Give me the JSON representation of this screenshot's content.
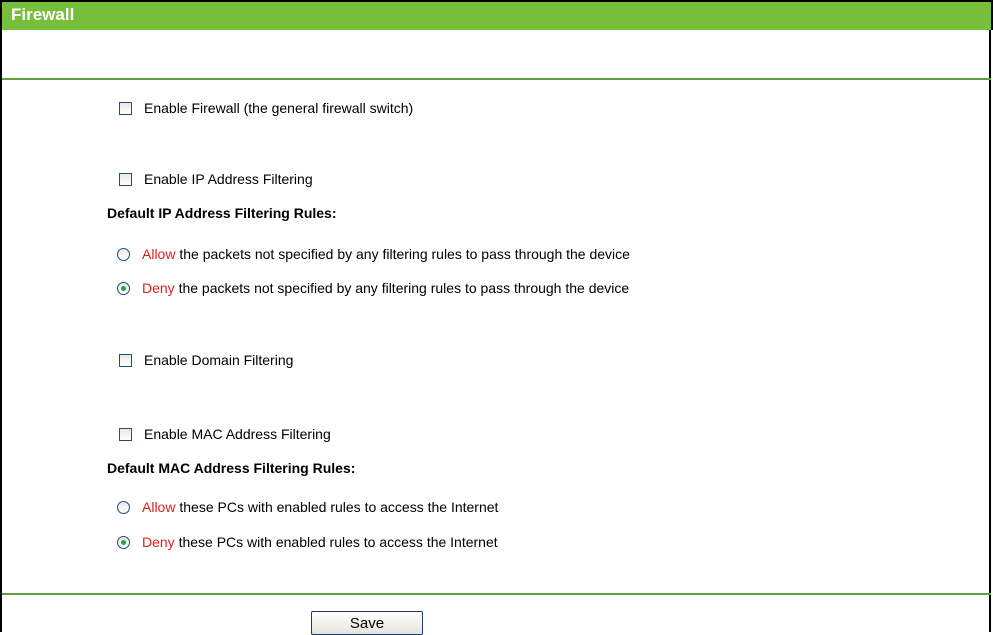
{
  "header": {
    "title": "Firewall"
  },
  "firewall": {
    "enable_label": "Enable Firewall (the general firewall switch)",
    "enabled": false
  },
  "ip_filtering": {
    "enable_label": "Enable IP Address Filtering",
    "enabled": false,
    "rules_heading": "Default IP Address Filtering Rules:",
    "allow_keyword": "Allow",
    "allow_text": " the packets not specified by any filtering rules to pass through the device",
    "deny_keyword": "Deny",
    "deny_text": " the packets not specified by any filtering rules to pass through the device",
    "selected": "deny"
  },
  "domain_filtering": {
    "enable_label": "Enable Domain Filtering",
    "enabled": false
  },
  "mac_filtering": {
    "enable_label": "Enable MAC Address Filtering",
    "enabled": false,
    "rules_heading": "Default MAC Address Filtering Rules:",
    "allow_keyword": "Allow",
    "allow_text": " these PCs with enabled rules to access the Internet",
    "deny_keyword": "Deny",
    "deny_text": " these PCs with enabled rules to access the Internet",
    "selected": "deny"
  },
  "actions": {
    "save_label": "Save"
  },
  "colors": {
    "header_bg": "#77be3a",
    "keyword": "#e02020",
    "divider": "#5e9f44"
  }
}
